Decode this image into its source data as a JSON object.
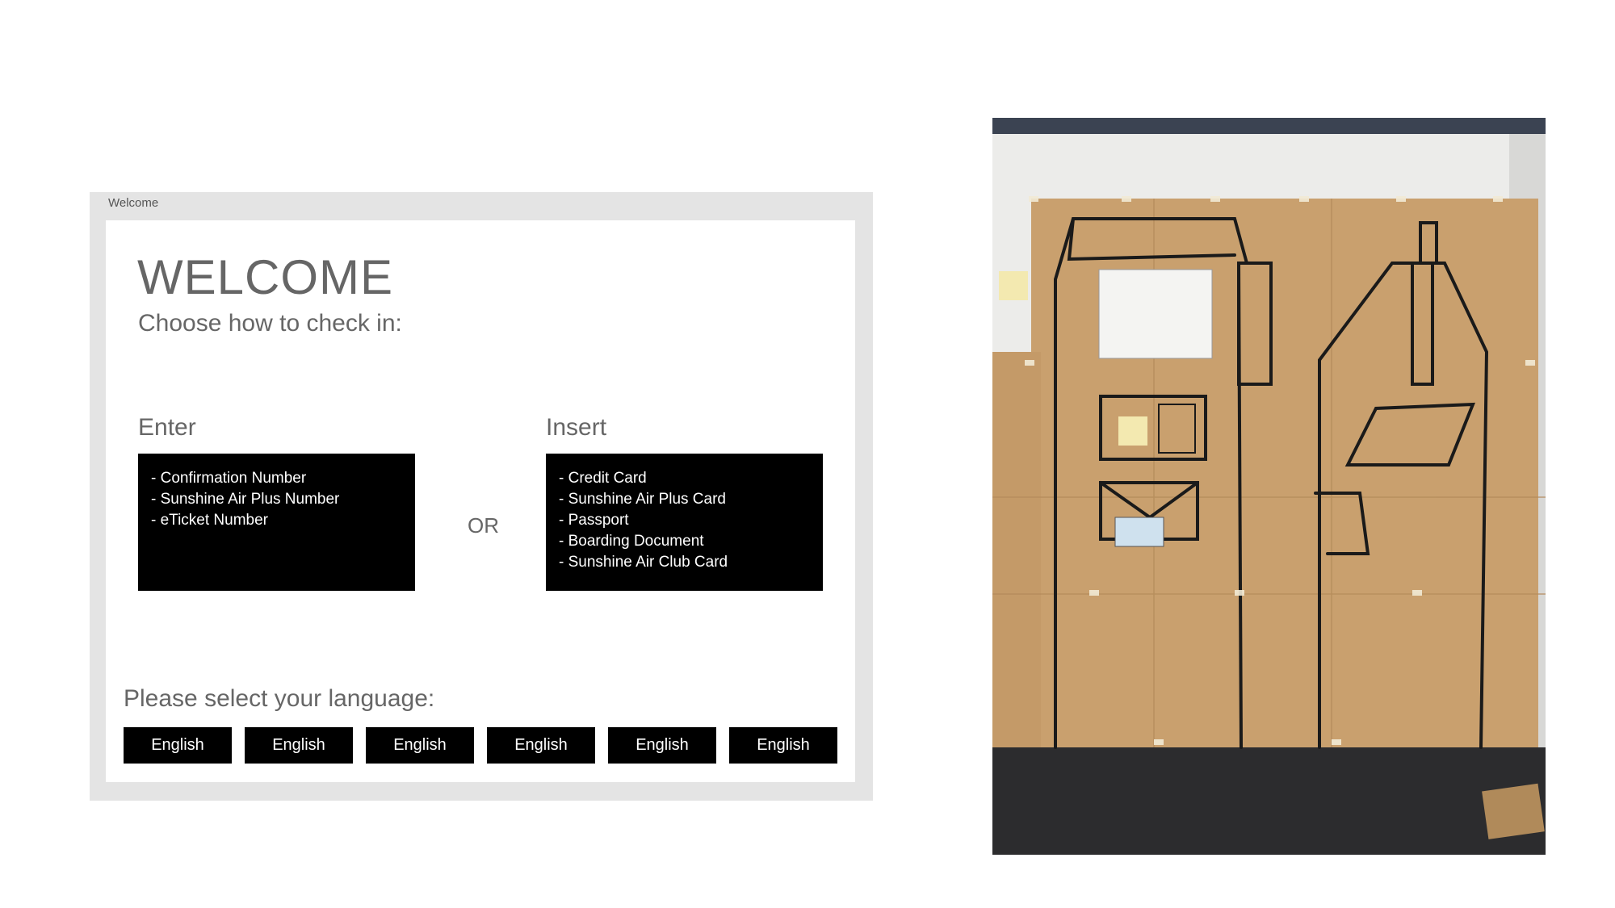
{
  "window": {
    "title": "Welcome",
    "heading": "WELCOME",
    "subheading": "Choose how to check in:",
    "enter": {
      "label": "Enter",
      "options": [
        "- Confirmation Number",
        "- Sunshine Air Plus Number",
        "- eTicket Number"
      ]
    },
    "or_label": "OR",
    "insert": {
      "label": "Insert",
      "options": [
        "- Credit Card",
        "- Sunshine Air Plus Card",
        "- Passport",
        "- Boarding Document",
        "- Sunshine Air Club Card"
      ]
    },
    "language_prompt": "Please select your language:",
    "language_buttons": [
      "English",
      "English",
      "English",
      "English",
      "English",
      "English"
    ]
  },
  "photo": {
    "subject": "paper-prototype-kiosk-photo"
  },
  "colors": {
    "window_frame": "#e4e4e4",
    "button_bg": "#000000",
    "button_text": "#ffffff",
    "muted_text": "#666666",
    "kraft_paper": "#c9a06e"
  }
}
